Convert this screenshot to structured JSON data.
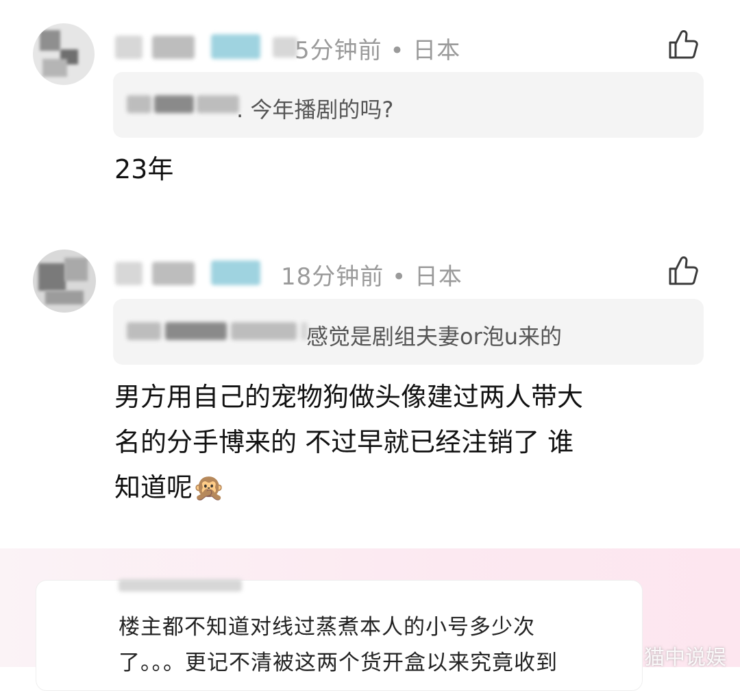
{
  "comments": [
    {
      "meta": "5分钟前 • 日本",
      "quote": ". 今年播剧的吗?",
      "body": "23年"
    },
    {
      "meta": "18分钟前 • 日本",
      "quote": "感觉是剧组夫妻or泡u来的",
      "body_lines": [
        "男方用自己的宠物狗做头像建过两人带大",
        "名的分手博来的 不过早就已经注销了 谁",
        "知道呢🙊"
      ]
    }
  ],
  "bottom_card": {
    "line1": "楼主都不知道对线过蒸煮本人的小号多少次",
    "line2": "了。。。更记不清被这两个货开盒以来究竟收到",
    "watermark": "猫中说娱"
  },
  "icons": {
    "like": "thumbs-up-icon"
  },
  "colors": {
    "meta_gray": "#9a9a9a",
    "quote_bg": "#f4f4f4",
    "card_bg_pink": "#fde6ef"
  }
}
